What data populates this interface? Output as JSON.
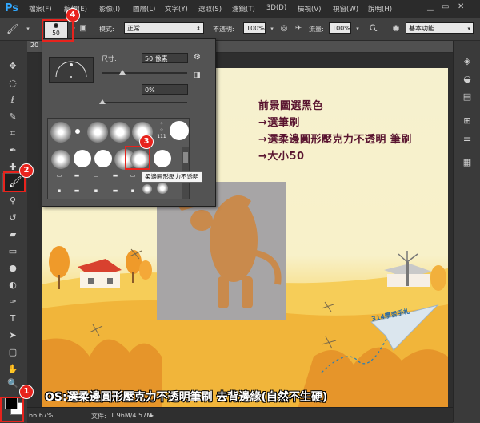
{
  "app": {
    "logo": "Ps"
  },
  "menu": [
    "檔案(F)",
    "編輯(E)",
    "影像(I)",
    "圖層(L)",
    "文字(Y)",
    "選取(S)",
    "濾鏡(T)",
    "3D(D)",
    "檢視(V)",
    "視窗(W)",
    "說明(H)"
  ],
  "options_bar": {
    "brush_size": "50",
    "mode_label": "模式:",
    "mode_value": "正常",
    "opacity_label": "不透明:",
    "opacity_value": "100%",
    "flow_label": "流量:",
    "flow_value": "100%",
    "workspace_value": "基本功能"
  },
  "doc_tab": {
    "label": "20"
  },
  "brush_popup": {
    "size_label": "尺寸:",
    "size_value": "50 像素",
    "hardness_value": "0%",
    "presets_row1": [
      {
        "type": "soft"
      },
      {
        "type": "hard-small"
      },
      {
        "type": "soft"
      },
      {
        "type": "soft"
      },
      {
        "type": "soft"
      },
      {
        "type": "dots",
        "label": "111"
      },
      {
        "type": "hard-large"
      }
    ],
    "presets_row2": [
      {
        "type": "soft"
      },
      {
        "type": "hard"
      },
      {
        "type": "hard"
      },
      {
        "type": "soft"
      },
      {
        "type": "soft-selected"
      },
      {
        "type": "hard"
      }
    ],
    "tooltip": "柔邊圓形壓力不透明"
  },
  "instructions": {
    "line1": "前景圖選黑色",
    "line2": "→選筆刷",
    "line3": "→選柔邊圓形壓克力不透明 筆刷",
    "line4": "→大小50"
  },
  "watermark": "314學習手札",
  "os_note": "OS:選柔邊圓形壓克力不透明筆刷 去背邊緣(自然不生硬)",
  "status": {
    "zoom": "66.67%",
    "doc_label": "文件:",
    "doc_value": "1.96M/4.57M"
  },
  "callouts": [
    "1",
    "2",
    "3",
    "4"
  ],
  "colors": {
    "callout_red": "#e8231d",
    "instruction_text": "#5a1530",
    "ps_blue": "#31a8ff"
  }
}
